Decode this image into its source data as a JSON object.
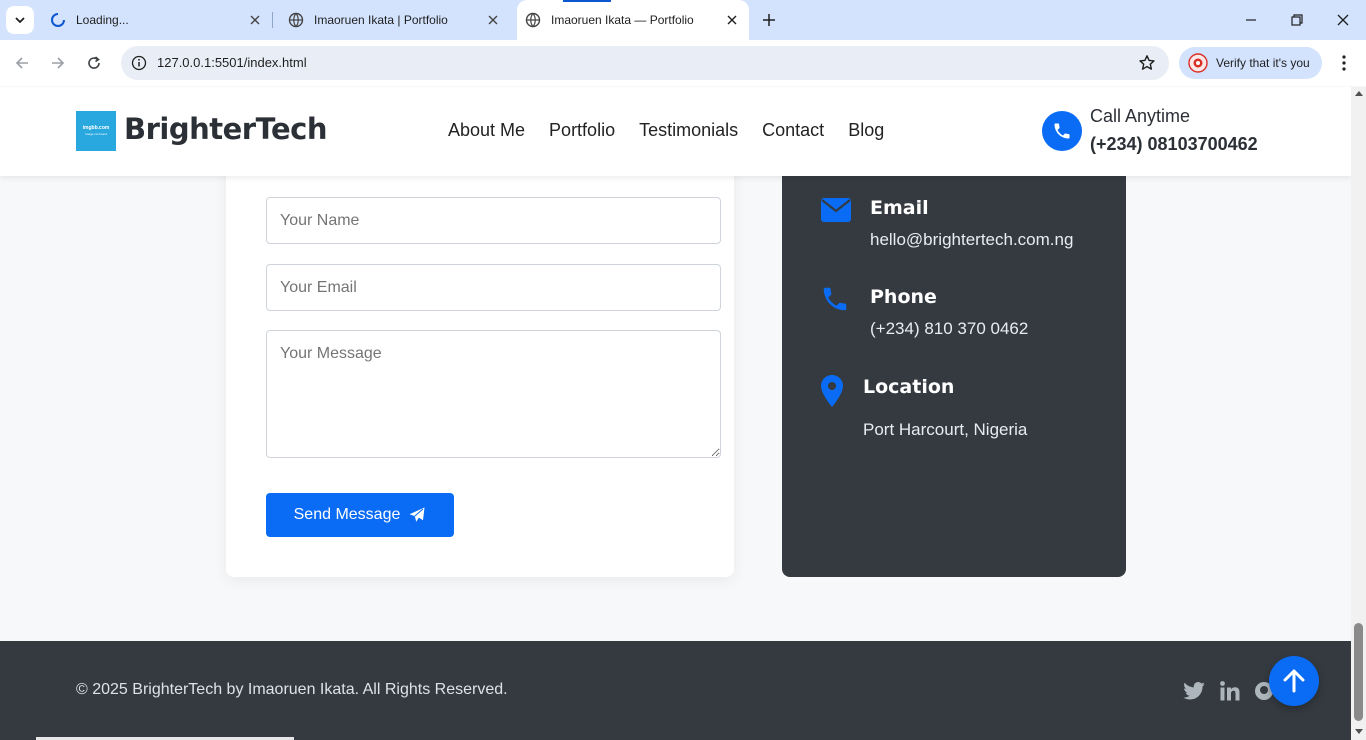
{
  "browser": {
    "tabs": [
      {
        "title": "Loading...",
        "state": "loading"
      },
      {
        "title": "Imaoruen Ikata | Portfolio",
        "state": "inactive"
      },
      {
        "title": "Imaoruen Ikata — Portfolio",
        "state": "active"
      }
    ],
    "url": "127.0.0.1:5501/index.html",
    "profile_chip": "Verify that it's you",
    "accent_color": "#0b57d0"
  },
  "header": {
    "logo_line1": "imgbb.com",
    "logo_line2": "image not found",
    "brand": "BrighterTech",
    "nav": [
      "About Me",
      "Portfolio",
      "Testimonials",
      "Contact",
      "Blog"
    ],
    "call_label": "Call Anytime",
    "call_number": "(+234) 08103700462"
  },
  "form": {
    "name_placeholder": "Your Name",
    "email_placeholder": "Your Email",
    "message_placeholder": "Your Message",
    "send_label": "Send Message"
  },
  "info": {
    "email_title": "Email",
    "email_value": "hello@brightertech.com.ng",
    "phone_title": "Phone",
    "phone_value": "(+234) 810 370 0462",
    "location_title": "Location",
    "location_value": "Port Harcourt, Nigeria"
  },
  "footer": {
    "copyright": "© 2025 BrighterTech by Imaoruen Ikata. All Rights Reserved.",
    "social": [
      "twitter-icon",
      "linkedin-icon",
      "github-icon"
    ]
  },
  "colors": {
    "primary": "#0a6cf5",
    "dark": "#343a40"
  }
}
